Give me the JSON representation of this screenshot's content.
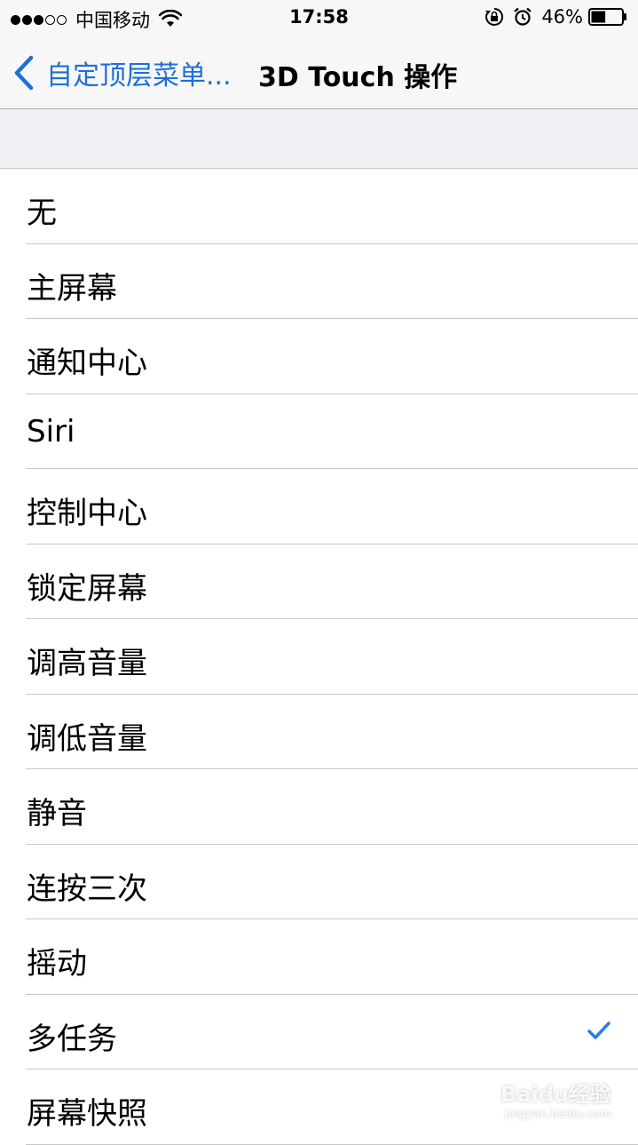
{
  "status_bar": {
    "carrier": "中国移动",
    "time": "17:58",
    "battery_percent": "46%",
    "battery_level": 0.46,
    "signal_bars": 3
  },
  "nav": {
    "back_label": "自定顶层菜单...",
    "title": "3D Touch 操作"
  },
  "options": [
    {
      "label": "无",
      "selected": false
    },
    {
      "label": "主屏幕",
      "selected": false
    },
    {
      "label": "通知中心",
      "selected": false
    },
    {
      "label": "Siri",
      "selected": false
    },
    {
      "label": "控制中心",
      "selected": false
    },
    {
      "label": "锁定屏幕",
      "selected": false
    },
    {
      "label": "调高音量",
      "selected": false
    },
    {
      "label": "调低音量",
      "selected": false
    },
    {
      "label": "静音",
      "selected": false
    },
    {
      "label": "连按三次",
      "selected": false
    },
    {
      "label": "摇动",
      "selected": false
    },
    {
      "label": "多任务",
      "selected": true
    },
    {
      "label": "屏幕快照",
      "selected": false
    }
  ],
  "watermark": {
    "brand": "Baidu经验",
    "url": "jingyan.baidu.com"
  },
  "colors": {
    "accent": "#1e6fd9",
    "check": "#2b7de0",
    "separator": "#c8c7cc",
    "group_bg": "#efeff4"
  }
}
